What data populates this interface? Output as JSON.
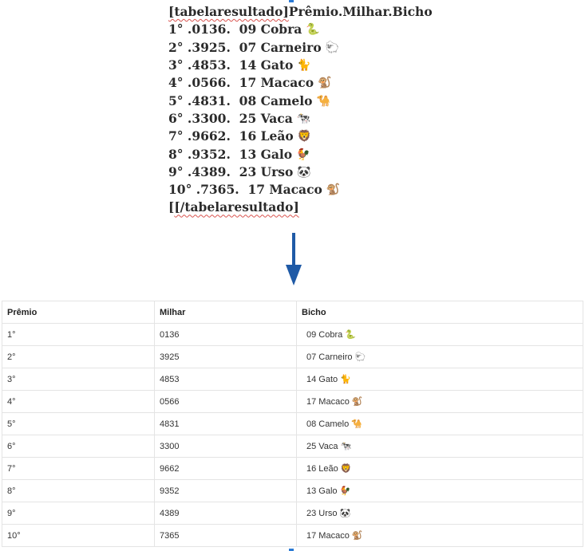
{
  "document": {
    "open_tag": "[tabelaresultado]",
    "header_text": "Prêmio.Milhar.Bicho",
    "close_tag": "[/tabelaresultado]",
    "lines": [
      {
        "premio": "1°",
        "milhar": ".0136.",
        "bicho": "09 Cobra",
        "emoji": "🐍"
      },
      {
        "premio": "2°",
        "milhar": ".3925.",
        "bicho": "07 Carneiro",
        "emoji": "🐑"
      },
      {
        "premio": "3°",
        "milhar": ".4853.",
        "bicho": "14 Gato",
        "emoji": "🐈"
      },
      {
        "premio": "4°",
        "milhar": ".0566.",
        "bicho": "17 Macaco",
        "emoji": "🐒"
      },
      {
        "premio": "5°",
        "milhar": ".4831.",
        "bicho": "08 Camelo",
        "emoji": "🐪"
      },
      {
        "premio": "6°",
        "milhar": ".3300.",
        "bicho": "25 Vaca",
        "emoji": "🐄"
      },
      {
        "premio": "7°",
        "milhar": ".9662.",
        "bicho": "16 Leão",
        "emoji": "🦁"
      },
      {
        "premio": "8°",
        "milhar": ".9352.",
        "bicho": "13 Galo",
        "emoji": "🐓"
      },
      {
        "premio": "9°",
        "milhar": ".4389.",
        "bicho": "23 Urso",
        "emoji": "🐼"
      },
      {
        "premio": "10°",
        "milhar": ".7365.",
        "bicho": "17 Macaco",
        "emoji": "🐒"
      }
    ]
  },
  "arrow_color": "#1f5aa6",
  "table": {
    "headers": [
      "Prêmio",
      "Milhar",
      "Bicho"
    ],
    "rows": [
      {
        "premio": "1°",
        "milhar": "0136",
        "bicho": "09 Cobra",
        "emoji": "🐍"
      },
      {
        "premio": "2°",
        "milhar": "3925",
        "bicho": "07 Carneiro",
        "emoji": "🐑"
      },
      {
        "premio": "3°",
        "milhar": "4853",
        "bicho": "14 Gato",
        "emoji": "🐈"
      },
      {
        "premio": "4°",
        "milhar": "0566",
        "bicho": "17 Macaco",
        "emoji": "🐒"
      },
      {
        "premio": "5°",
        "milhar": "4831",
        "bicho": "08 Camelo",
        "emoji": "🐪"
      },
      {
        "premio": "6°",
        "milhar": "3300",
        "bicho": "25 Vaca",
        "emoji": "🐄"
      },
      {
        "premio": "7°",
        "milhar": "9662",
        "bicho": "16 Leão",
        "emoji": "🦁"
      },
      {
        "premio": "8°",
        "milhar": "9352",
        "bicho": "13 Galo",
        "emoji": "🐓"
      },
      {
        "premio": "9°",
        "milhar": "4389",
        "bicho": "23 Urso",
        "emoji": "🐼"
      },
      {
        "premio": "10°",
        "milhar": "7365",
        "bicho": "17 Macaco",
        "emoji": "🐒"
      }
    ]
  }
}
